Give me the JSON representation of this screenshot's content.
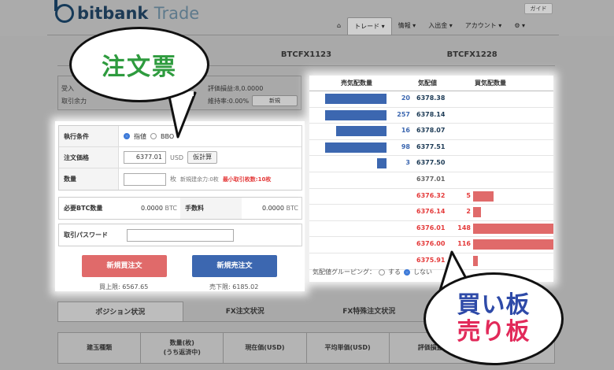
{
  "header": {
    "brand": "bitbank",
    "brand_sub": "Trade",
    "guide": "ガイド",
    "nav": [
      {
        "label": "⌂"
      },
      {
        "label": "トレード ▾"
      },
      {
        "label": "情報 ▾"
      },
      {
        "label": "入出金 ▾"
      },
      {
        "label": "アカウント ▾"
      },
      {
        "label": "⚙ ▾"
      }
    ]
  },
  "top_tabs": [
    "",
    "BTCFX1123",
    "BTCFX1228"
  ],
  "status": {
    "row1": "受入",
    "row2": "取引余力",
    "pnl": "評価損益:8,0.0000",
    "margin_rate": "維持率:0.00%",
    "new_btn": "新規"
  },
  "ticket": {
    "exec_label": "執行条件",
    "opt_limit": "指値",
    "opt_bbo": "BBO",
    "price_label": "注文価格",
    "price_value": "6377.01",
    "price_unit": "USD",
    "calc_btn": "仮計算",
    "qty_label": "数量",
    "qty_unit": "枚",
    "qty_avail": "新規建余力:0枚",
    "qty_min": "最小取引枚数:10枚",
    "btc_label": "必要BTC数量",
    "btc_value": "0.0000",
    "btc_unit": "BTC",
    "fee_label": "手数料",
    "fee_value": "0.0000",
    "fee_unit": "BTC",
    "pw_label": "取引パスワード",
    "buy_btn": "新規買注文",
    "sell_btn": "新規売注文",
    "buy_limit": "買上限: 6567.65",
    "sell_limit": "売下限: 6185.02"
  },
  "book": {
    "head_sell": "売気配数量",
    "head_price": "気配値",
    "head_buy": "買気配数量",
    "grouping_label": "気配値グルーピング：",
    "grouping_on": "する",
    "grouping_off": "しない",
    "rows": [
      {
        "sell": "20",
        "price": "6378.38",
        "buy": "",
        "sell_frac": 0.8,
        "buy_frac": 0,
        "price_color": "#1c3a55"
      },
      {
        "sell": "257",
        "price": "6378.14",
        "buy": "",
        "sell_frac": 0.8,
        "buy_frac": 0,
        "price_color": "#1c3a55"
      },
      {
        "sell": "16",
        "price": "6378.07",
        "buy": "",
        "sell_frac": 0.65,
        "buy_frac": 0,
        "price_color": "#1c3a55"
      },
      {
        "sell": "98",
        "price": "6377.51",
        "buy": "",
        "sell_frac": 0.8,
        "buy_frac": 0,
        "price_color": "#1c3a55"
      },
      {
        "sell": "3",
        "price": "6377.50",
        "buy": "",
        "sell_frac": 0.12,
        "buy_frac": 0,
        "price_color": "#1c3a55"
      },
      {
        "sell": "",
        "price": "6377.01",
        "buy": "",
        "sell_frac": 0,
        "buy_frac": 0,
        "price_color": "#666666"
      },
      {
        "sell": "",
        "price": "6376.32",
        "buy": "5",
        "sell_frac": 0,
        "buy_frac": 0.25,
        "price_color": "#e43a3a"
      },
      {
        "sell": "",
        "price": "6376.14",
        "buy": "2",
        "sell_frac": 0,
        "buy_frac": 0.1,
        "price_color": "#e43a3a"
      },
      {
        "sell": "",
        "price": "6376.01",
        "buy": "148",
        "sell_frac": 0,
        "buy_frac": 1.0,
        "price_color": "#e43a3a"
      },
      {
        "sell": "",
        "price": "6376.00",
        "buy": "116",
        "sell_frac": 0,
        "buy_frac": 1.0,
        "price_color": "#e43a3a"
      },
      {
        "sell": "",
        "price": "6375.91",
        "buy": "",
        "sell_frac": 0,
        "buy_frac": 0.06,
        "price_color": "#e43a3a"
      }
    ]
  },
  "bottom_tabs": [
    "ポジション状況",
    "FX注文状況",
    "FX特殊注文状況",
    ""
  ],
  "positions_cols": [
    {
      "l1": "建玉種類",
      "l2": ""
    },
    {
      "l1": "数量(枚)",
      "l2": "(うち返済中)"
    },
    {
      "l1": "現在価(USD)",
      "l2": ""
    },
    {
      "l1": "平均単価(USD)",
      "l2": ""
    },
    {
      "l1": "評価損益",
      "l2": ""
    },
    {
      "l1": "",
      "l2": ""
    }
  ],
  "callouts": {
    "ticket": "注文票",
    "buy_board": "買い板",
    "sell_board": "売り板"
  }
}
